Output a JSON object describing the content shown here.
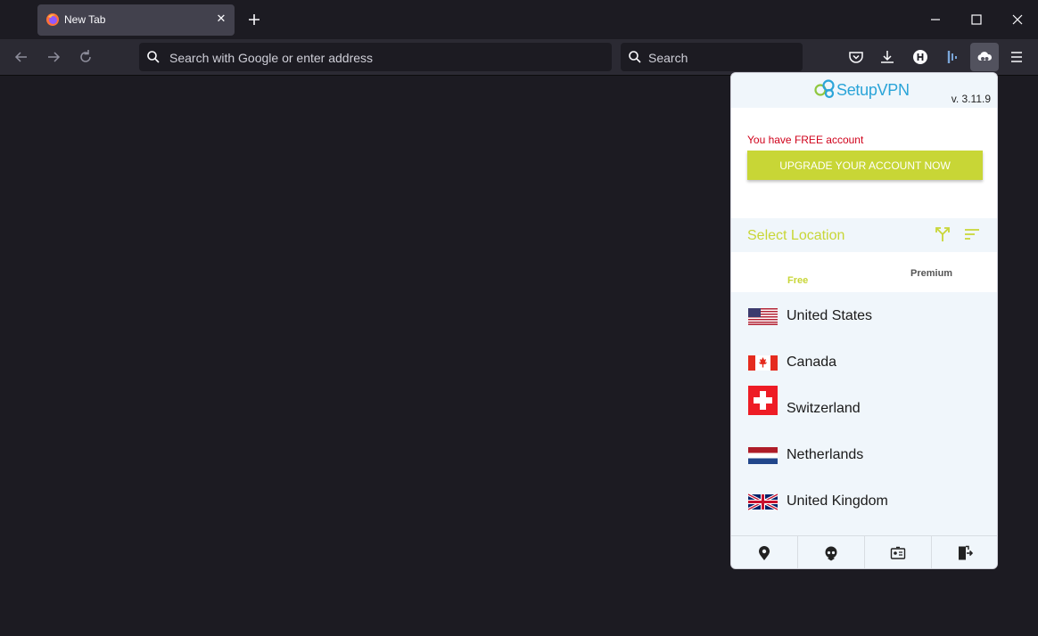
{
  "browser": {
    "tab_title": "New Tab",
    "url_placeholder": "Search with Google or enter address",
    "search_placeholder": "Search"
  },
  "vpn": {
    "logo_text": "SetupVPN",
    "version": "v. 3.11.9",
    "account_status": "You have FREE account",
    "upgrade_label": "UPGRADE YOUR ACCOUNT NOW",
    "select_location_label": "Select Location",
    "tabs": {
      "free": "Free",
      "premium": "Premium"
    },
    "locations": [
      {
        "name": "United States",
        "flag": "us-flag"
      },
      {
        "name": "Canada",
        "flag": "ca-flag"
      },
      {
        "name": "Switzerland",
        "flag": "ch-flag"
      },
      {
        "name": "Netherlands",
        "flag": "nl-flag"
      },
      {
        "name": "United Kingdom",
        "flag": "uk-flag"
      }
    ],
    "footer_icons": [
      "ip-location-icon",
      "user-agent-icon",
      "id-card-icon",
      "logout-icon"
    ],
    "accent_color": "#c8d636",
    "brand_color": "#2aa4d8"
  }
}
